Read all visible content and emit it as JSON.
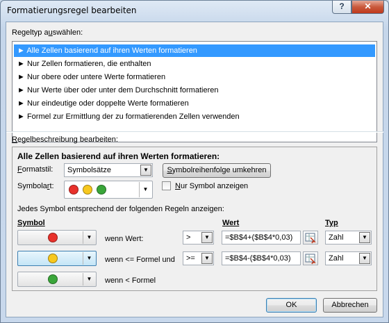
{
  "window": {
    "title": "Formatierungsregel bearbeiten",
    "help_label": "?",
    "close_label": "✕"
  },
  "rule_type": {
    "heading_pre": "Regeltyp a",
    "heading_ul": "u",
    "heading_post": "swählen:",
    "items": [
      "► Alle Zellen basierend auf ihren Werten formatieren",
      "► Nur Zellen formatieren, die enthalten",
      "► Nur obere oder untere Werte formatieren",
      "► Nur Werte über oder unter dem Durchschnitt formatieren",
      "► Nur eindeutige oder doppelte Werte formatieren",
      "► Formel zur Ermittlung der zu formatierenden Zellen verwenden"
    ],
    "selected_index": 0
  },
  "rule_desc": {
    "heading_pre": "",
    "heading_ul": "R",
    "heading_post": "egelbeschreibung bearbeiten:",
    "title": "Alle Zellen basierend auf ihren Werten formatieren:",
    "formatstil_ul": "F",
    "formatstil_post": "ormatstil:",
    "formatstil_value": "Symbolsätze",
    "reverse_btn_pre": "S",
    "reverse_btn_post": "ymbolreihenfolge umkehren",
    "symbolart_pre": "Symbola",
    "symbolart_ul": "r",
    "symbolart_post": "t:",
    "only_symbol_pre": "N",
    "only_symbol_post": "ur Symbol anzeigen",
    "only_symbol_checked": false,
    "rules_intro": "Jedes Symbol entsprechend der folgenden Regeln anzeigen:",
    "col_symbol": "Symbol",
    "col_wert": "Wert",
    "col_typ": "Typ",
    "rows": [
      {
        "symbol_color": "#e8312b",
        "condition": "wenn Wert:",
        "operator": ">",
        "value": "=$B$4+($B$4*0,03)",
        "type": "Zahl"
      },
      {
        "symbol_color": "#f7c81e",
        "condition": "wenn <= Formel und",
        "operator": ">=",
        "value": "=$B$4-($B$4*0,03)",
        "type": "Zahl"
      },
      {
        "symbol_color": "#3aa63a",
        "condition": "wenn < Formel",
        "operator": "",
        "value": "",
        "type": ""
      }
    ],
    "symbolart_colors": [
      "#e8312b",
      "#f7c81e",
      "#3aa63a"
    ]
  },
  "footer": {
    "ok_label": "OK",
    "cancel_label": "Abbrechen"
  }
}
